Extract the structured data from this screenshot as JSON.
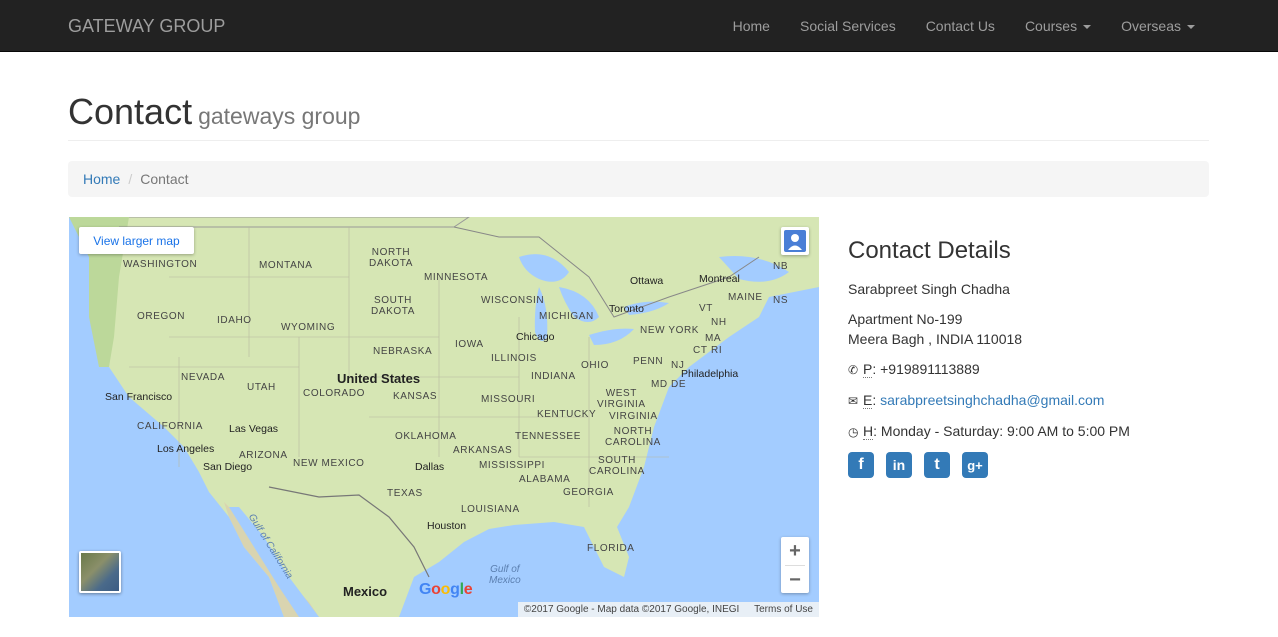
{
  "navbar": {
    "brand": "GATEWAY GROUP",
    "items": [
      {
        "label": "Home"
      },
      {
        "label": "Social Services"
      },
      {
        "label": "Contact Us"
      },
      {
        "label": "Courses"
      },
      {
        "label": "Overseas"
      }
    ]
  },
  "header": {
    "title": "Contact",
    "subtitle": "gateways group"
  },
  "breadcrumb": {
    "home": "Home",
    "separator": "/",
    "current": "Contact"
  },
  "map": {
    "view_larger": "View larger map",
    "attribution": "©2017 Google - Map data ©2017 Google, INEGI",
    "terms": "Terms of Use",
    "zoom_in": "+",
    "zoom_out": "−",
    "google_logo": "Google",
    "labels": {
      "washington": "WASHINGTON",
      "montana": "MONTANA",
      "north_dakota": "NORTH\nDAKOTA",
      "minnesota": "MINNESOTA",
      "south_dakota": "SOUTH\nDAKOTA",
      "wisconsin": "WISCONSIN",
      "michigan": "MICHIGAN",
      "oregon": "OREGON",
      "idaho": "IDAHO",
      "wyoming": "WYOMING",
      "nebraska": "NEBRASKA",
      "iowa": "IOWA",
      "illinois": "ILLINOIS",
      "indiana": "INDIANA",
      "ohio": "OHIO",
      "penn": "PENN",
      "new_york": "NEW YORK",
      "nevada": "NEVADA",
      "utah": "UTAH",
      "colorado": "COLORADO",
      "kansas": "KANSAS",
      "missouri": "MISSOURI",
      "kentucky": "KENTUCKY",
      "west_virginia": "WEST\nVIRGINIA",
      "virginia": "VIRGINIA",
      "california": "CALIFORNIA",
      "arizona": "ARIZONA",
      "new_mexico": "NEW MEXICO",
      "oklahoma": "OKLAHOMA",
      "arkansas": "ARKANSAS",
      "tennessee": "TENNESSEE",
      "north_carolina": "NORTH\nCAROLINA",
      "south_carolina": "SOUTH\nCAROLINA",
      "mississippi": "MISSISSIPPI",
      "alabama": "ALABAMA",
      "georgia": "GEORGIA",
      "texas": "TEXAS",
      "louisiana": "LOUISIANA",
      "florida": "FLORIDA",
      "maine": "MAINE",
      "vt": "VT",
      "nh": "NH",
      "ma": "MA",
      "ct": "CT",
      "ri": "RI",
      "nj": "NJ",
      "de": "DE",
      "md": "MD",
      "nb": "NB",
      "ns": "NS"
    },
    "cities": {
      "ottawa": "Ottawa",
      "montreal": "Montreal",
      "toronto": "Toronto",
      "chicago": "Chicago",
      "philadelphia": "Philadelphia",
      "san_francisco": "San Francisco",
      "las_vegas": "Las Vegas",
      "los_angeles": "Los Angeles",
      "san_diego": "San Diego",
      "dallas": "Dallas",
      "houston": "Houston"
    },
    "countries": {
      "united_states": "United States",
      "mexico": "Mexico"
    },
    "water": {
      "gulf_of_mexico": "Gulf of\nMexico",
      "gulf_of_california": "Gulf of California"
    }
  },
  "contact": {
    "heading": "Contact Details",
    "name": "Sarabpreet Singh Chadha",
    "address_line1": "Apartment No-199",
    "address_line2": "Meera Bagh , INDIA 110018",
    "phone_label": "P",
    "phone": "+919891113889",
    "email_label": "E",
    "email": "sarabpreetsinghchadha@gmail.com",
    "hours_label": "H",
    "hours": "Monday - Saturday: 9:00 AM to 5:00 PM",
    "social": [
      {
        "icon": "facebook-icon",
        "glyph": "f"
      },
      {
        "icon": "linkedin-icon",
        "glyph": "in"
      },
      {
        "icon": "twitter-icon",
        "glyph": "t"
      },
      {
        "icon": "google-plus-icon",
        "glyph": "g+"
      }
    ]
  },
  "colors": {
    "navbar_bg": "#222222",
    "link": "#337ab7",
    "map_land": "#c8e0a8",
    "map_water": "#a3ccff"
  }
}
